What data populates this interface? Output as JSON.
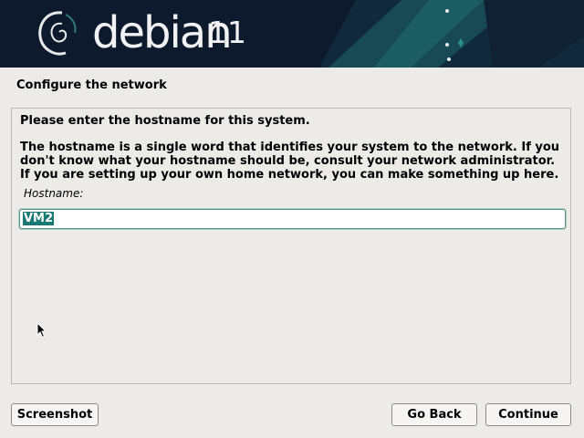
{
  "banner": {
    "brand": "debian",
    "version": "11",
    "colors": {
      "background": "#0d1a2e",
      "accent": "#1a5a5e"
    }
  },
  "section_title": "Configure the network",
  "panel": {
    "prompt": "Please enter the hostname for this system.",
    "description": "The hostname is a single word that identifies your system to the network. If you don't know what your hostname should be, consult your network administrator. If you are setting up your own home network, you can make something up here.",
    "field_label": "Hostname:",
    "hostname_value": "VM2"
  },
  "buttons": {
    "screenshot": "Screenshot",
    "go_back": "Go Back",
    "continue": "Continue"
  },
  "colors": {
    "selection": "#197a73",
    "focus_border": "#5a8b82"
  }
}
